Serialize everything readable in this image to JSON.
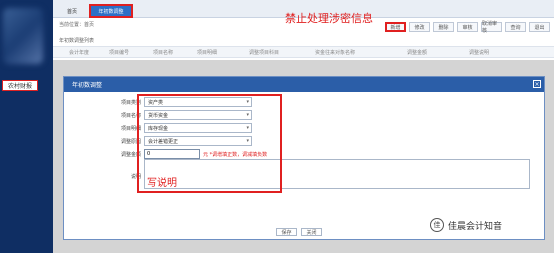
{
  "left_nav": {
    "selected_item": "农村财报"
  },
  "tabs": [
    {
      "label": "首页"
    },
    {
      "label": "年初数调整"
    }
  ],
  "annotation_top": "禁止处理涉密信息",
  "breadcrumb": "当前位置：首页",
  "toolbar": {
    "buttons": [
      "新增",
      "修改",
      "删除",
      "审核",
      "取消审核",
      "查询",
      "退出"
    ]
  },
  "grid": {
    "title": "年初数调整列表",
    "columns": [
      "会计年度",
      "项目编号",
      "项目名称",
      "项目明细",
      "调整项目科目",
      "资金往来对象名称",
      "调整金额",
      "调整说明"
    ]
  },
  "dialog": {
    "title": "年初数调整",
    "fields": [
      {
        "label": "项目类别",
        "value": "资产类"
      },
      {
        "label": "项目名称",
        "value": "货币资金"
      },
      {
        "label": "项目明细",
        "value": "库存现金"
      },
      {
        "label": "调整原因",
        "value": "会计差错更正"
      }
    ],
    "amount": {
      "label": "调整金额",
      "value": "0",
      "hint": "元 *调增填正数，调减填负数"
    },
    "note_label": "说明",
    "annotation": "写说明",
    "buttons": [
      "保存",
      "关闭"
    ]
  },
  "brand": {
    "logo_text": "佳",
    "text": "佳晨会计知音"
  },
  "colors": {
    "accent": "#2b5ea8",
    "annotation": "#e02020",
    "nav": "#0f2e63"
  }
}
